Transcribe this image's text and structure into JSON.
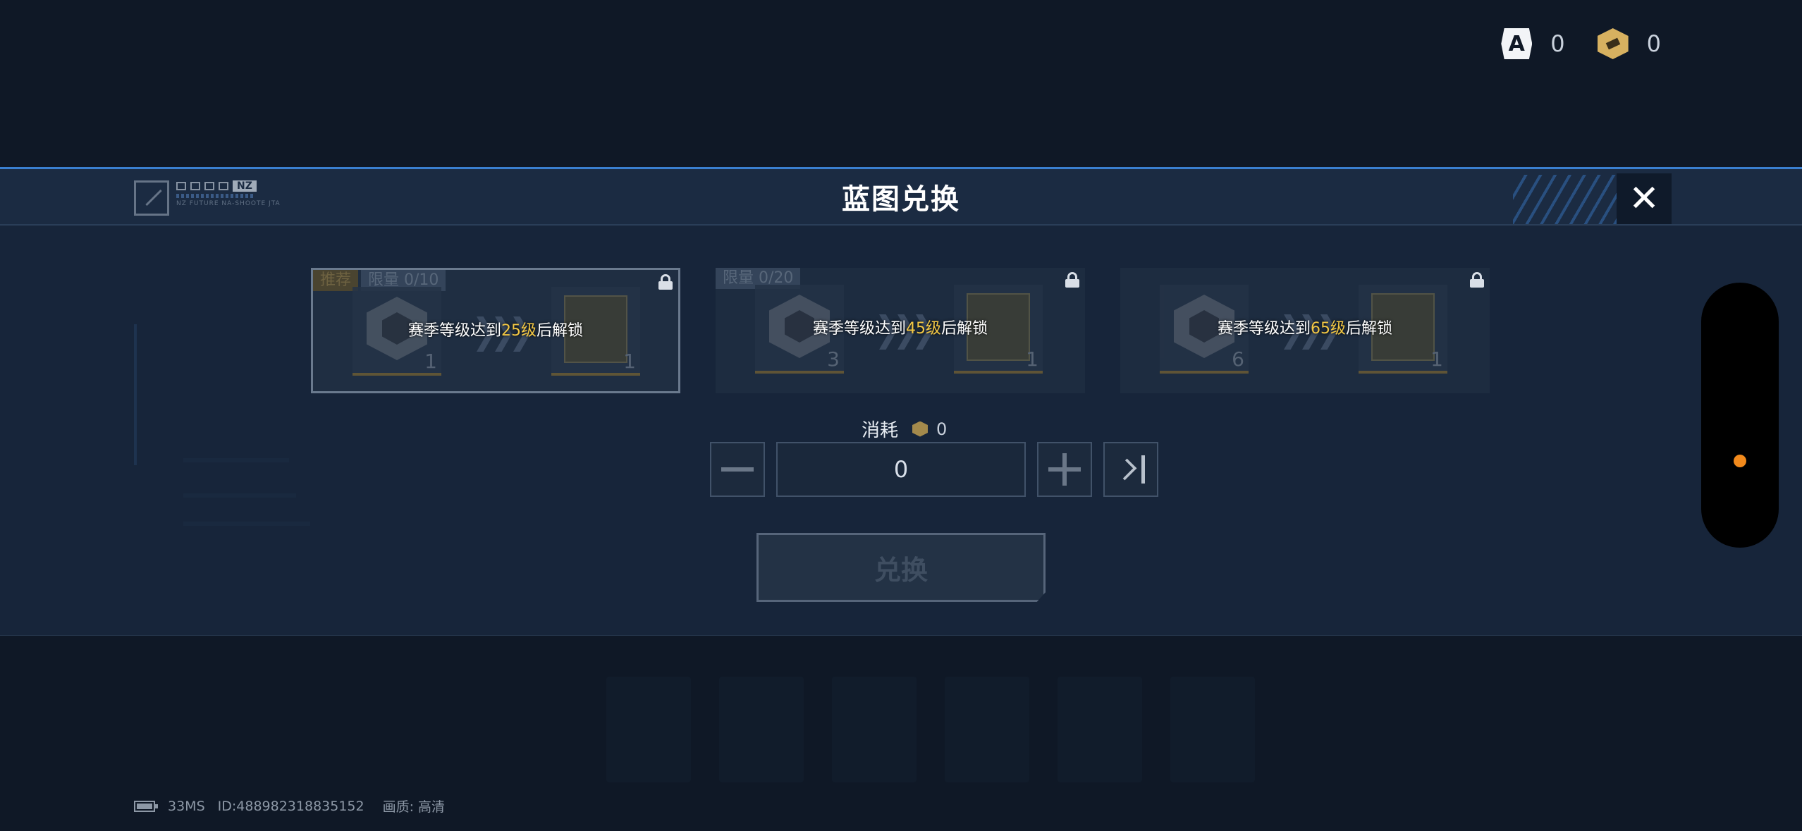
{
  "currency": {
    "blueprint_icon": "blueprint-icon",
    "blueprint_count": "0",
    "token_icon": "token-icon",
    "token_count": "0"
  },
  "modal": {
    "title": "蓝图兑换",
    "logo_badge": "NZ",
    "logo_small_text": "NZ FUTURE NA-SHOOTE  JTA",
    "close_icon": "close-icon"
  },
  "cards": [
    {
      "tags": [
        "推荐",
        "限量 0/10"
      ],
      "core_count": "1",
      "blueprint_count": "1",
      "unlock_prefix": "赛季等级达到",
      "unlock_level": "25级",
      "unlock_suffix": "后解锁",
      "selected": true
    },
    {
      "tags": [
        "限量 0/20"
      ],
      "core_count": "3",
      "blueprint_count": "1",
      "unlock_prefix": "赛季等级达到",
      "unlock_level": "45级",
      "unlock_suffix": "后解锁",
      "selected": false
    },
    {
      "tags": [],
      "core_count": "6",
      "blueprint_count": "1",
      "unlock_prefix": "赛季等级达到",
      "unlock_level": "65级",
      "unlock_suffix": "后解锁",
      "selected": false
    }
  ],
  "cost": {
    "label": "消耗",
    "value": "0"
  },
  "quantity": {
    "value": "0"
  },
  "exchange_button": {
    "label": "兑换"
  },
  "status_bar": {
    "ping": "33MS",
    "id": "ID:488982318835152",
    "quality": "画质:  高清"
  },
  "colors": {
    "accent_blue": "#3a7fd0",
    "level_highlight": "#f2c744",
    "notification_dot": "#f28a1c"
  }
}
